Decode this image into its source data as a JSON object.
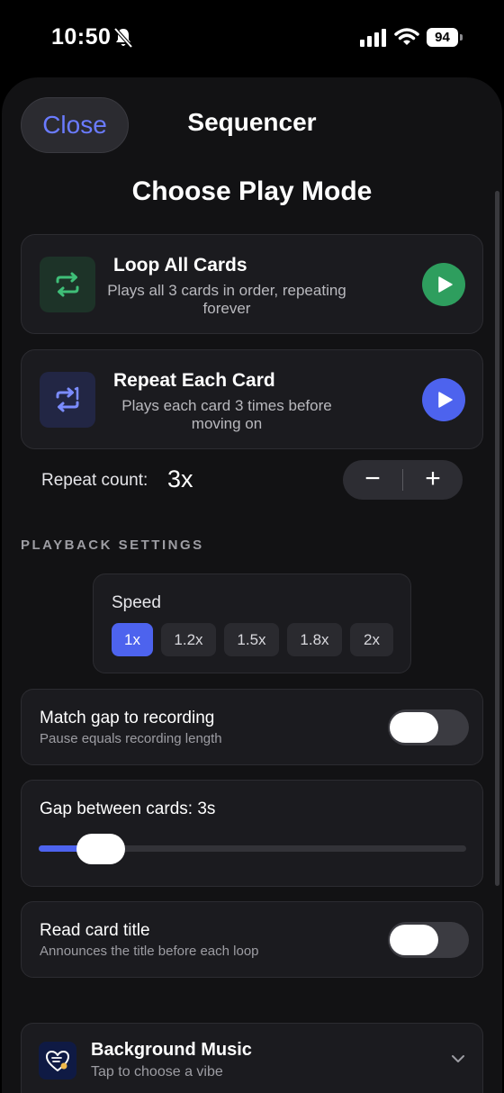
{
  "status": {
    "time": "10:50",
    "battery": "94"
  },
  "header": {
    "close_label": "Close",
    "title": "Sequencer"
  },
  "play_mode": {
    "heading": "Choose Play Mode",
    "options": [
      {
        "title": "Loop All Cards",
        "description": "Plays all 3 cards in order, repeating forever",
        "icon": "loop-icon",
        "accent": "#2e9e5e"
      },
      {
        "title": "Repeat Each Card",
        "description": "Plays each card 3 times before moving on",
        "icon": "repeat-icon",
        "accent": "#4d63ee"
      }
    ],
    "repeat_count_label": "Repeat count:",
    "repeat_count_value": "3x",
    "stepper_minus": "−",
    "stepper_plus": "+"
  },
  "playback": {
    "section_label": "PLAYBACK SETTINGS",
    "speed": {
      "label": "Speed",
      "options": [
        "1x",
        "1.2x",
        "1.5x",
        "1.8x",
        "2x"
      ],
      "selected": "1x"
    },
    "match_gap": {
      "title": "Match gap to recording",
      "subtitle": "Pause equals recording length",
      "enabled": false
    },
    "gap": {
      "label": "Gap between cards: 3s",
      "value_seconds": 3,
      "fraction": 0.1
    },
    "read_title": {
      "title": "Read card title",
      "subtitle": "Announces the title before each loop",
      "enabled": false
    }
  },
  "music": {
    "title": "Background Music",
    "subtitle": "Tap to choose a vibe",
    "icon": "music-heart-icon"
  },
  "colors": {
    "accent": "#4d63ee",
    "green": "#2e9e5e",
    "background": "#121214"
  }
}
